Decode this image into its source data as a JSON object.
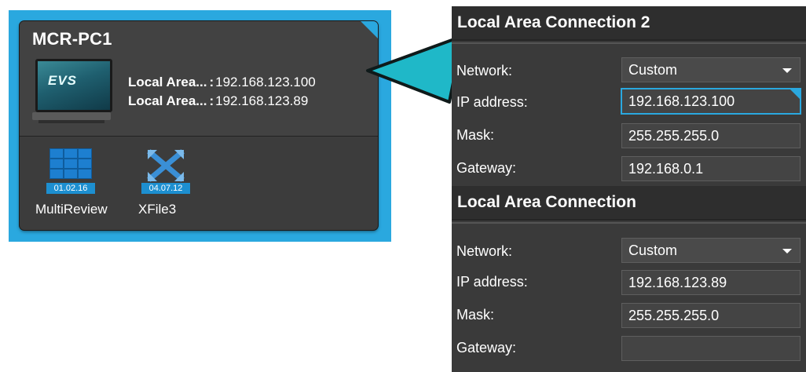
{
  "pc_card": {
    "name": "MCR-PC1",
    "monitor_logo": "EVS",
    "connections": [
      {
        "name": "Local Area...",
        "ip": "192.168.123.100"
      },
      {
        "name": "Local Area...",
        "ip": "192.168.123.89"
      }
    ],
    "apps": [
      {
        "label": "MultiReview",
        "version": "01.02.16",
        "icon": "grid-icon"
      },
      {
        "label": "XFile3",
        "version": "04.07.12",
        "icon": "xfile-icon"
      }
    ]
  },
  "settings": {
    "sections": [
      {
        "title": "Local Area Connection 2",
        "network_label": "Network:",
        "network_value": "Custom",
        "ip_label": "IP address:",
        "ip_value": "192.168.123.100",
        "mask_label": "Mask:",
        "mask_value": "255.255.255.0",
        "gateway_label": "Gateway:",
        "gateway_value": "192.168.0.1"
      },
      {
        "title": "Local Area Connection",
        "network_label": "Network:",
        "network_value": "Custom",
        "ip_label": "IP address:",
        "ip_value": "192.168.123.89",
        "mask_label": "Mask:",
        "mask_value": "255.255.255.0",
        "gateway_label": "Gateway:",
        "gateway_value": ""
      }
    ]
  },
  "colors": {
    "accent": "#2aa8df",
    "card_bg": "#3c3c3c",
    "panel_bg": "#3a3a3a",
    "arrow": "#1fb8c8"
  }
}
